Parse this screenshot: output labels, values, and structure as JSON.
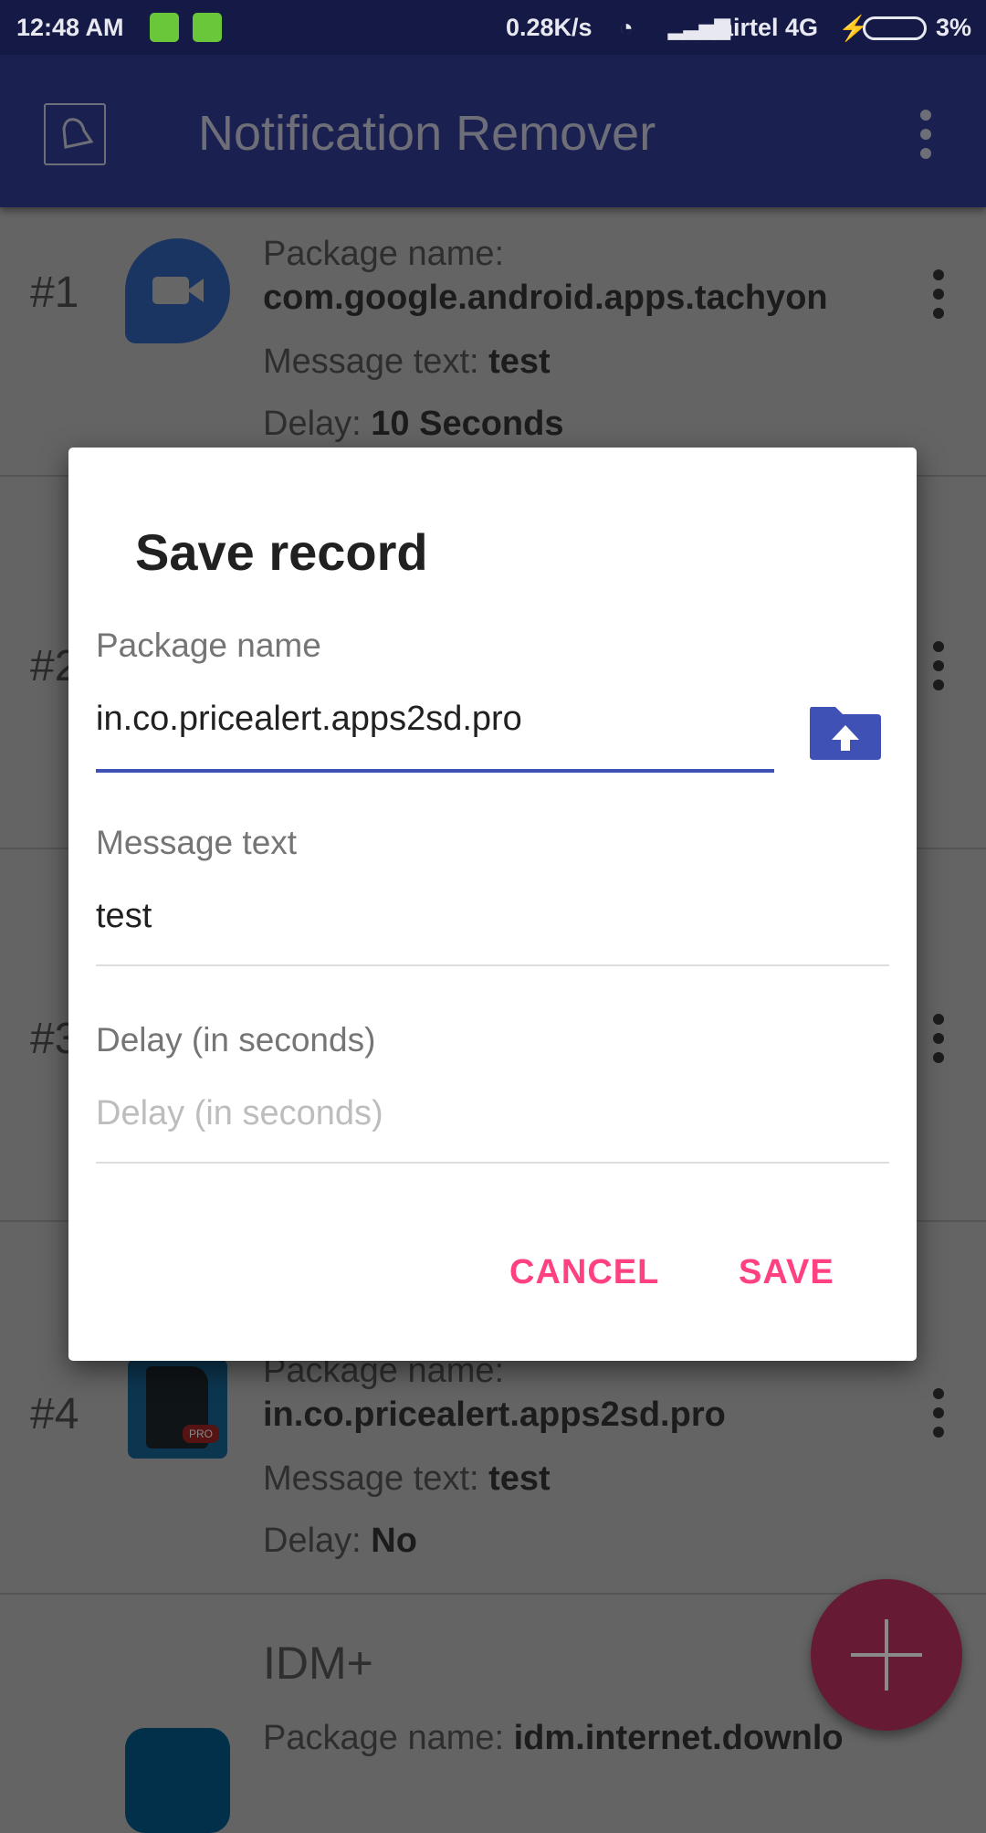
{
  "status_bar": {
    "time": "12:48 AM",
    "net_speed": "0.28K/s",
    "carrier": "airtel 4G",
    "battery": "3%"
  },
  "app_bar": {
    "title": "Notification Remover",
    "logo_icon": "bell-off-icon",
    "menu_icon": "more-vert-icon"
  },
  "records": [
    {
      "index": "#1",
      "package_label": "Package name:",
      "package": "com.google.android.apps.tachyon",
      "message_label": "Message text: ",
      "message": "test",
      "delay_label": "Delay: ",
      "delay": "10 Seconds",
      "icon": "google-duo-icon"
    },
    {
      "index": "#2"
    },
    {
      "index": "#3"
    },
    {
      "index": "#4",
      "package_label": "Package name:",
      "package": "in.co.pricealert.apps2sd.pro",
      "message_label": "Message text: ",
      "message": "test",
      "delay_label": "Delay: ",
      "delay": "No",
      "icon": "apps2sd-pro-icon"
    },
    {
      "title": "IDM+",
      "package_label": "Package name: ",
      "package": "idm.internet.downlo",
      "icon": "idm-plus-icon"
    }
  ],
  "dialog": {
    "title": "Save record",
    "package_label": "Package name",
    "package_value": "in.co.pricealert.apps2sd.pro",
    "message_label": "Message text",
    "message_value": "test",
    "delay_label": "Delay (in seconds)",
    "delay_placeholder": "Delay (in seconds)",
    "cancel": "CANCEL",
    "save": "SAVE"
  },
  "colors": {
    "primary": "#3f51b5",
    "accent": "#ff4081",
    "status_bar": "#141a45"
  }
}
